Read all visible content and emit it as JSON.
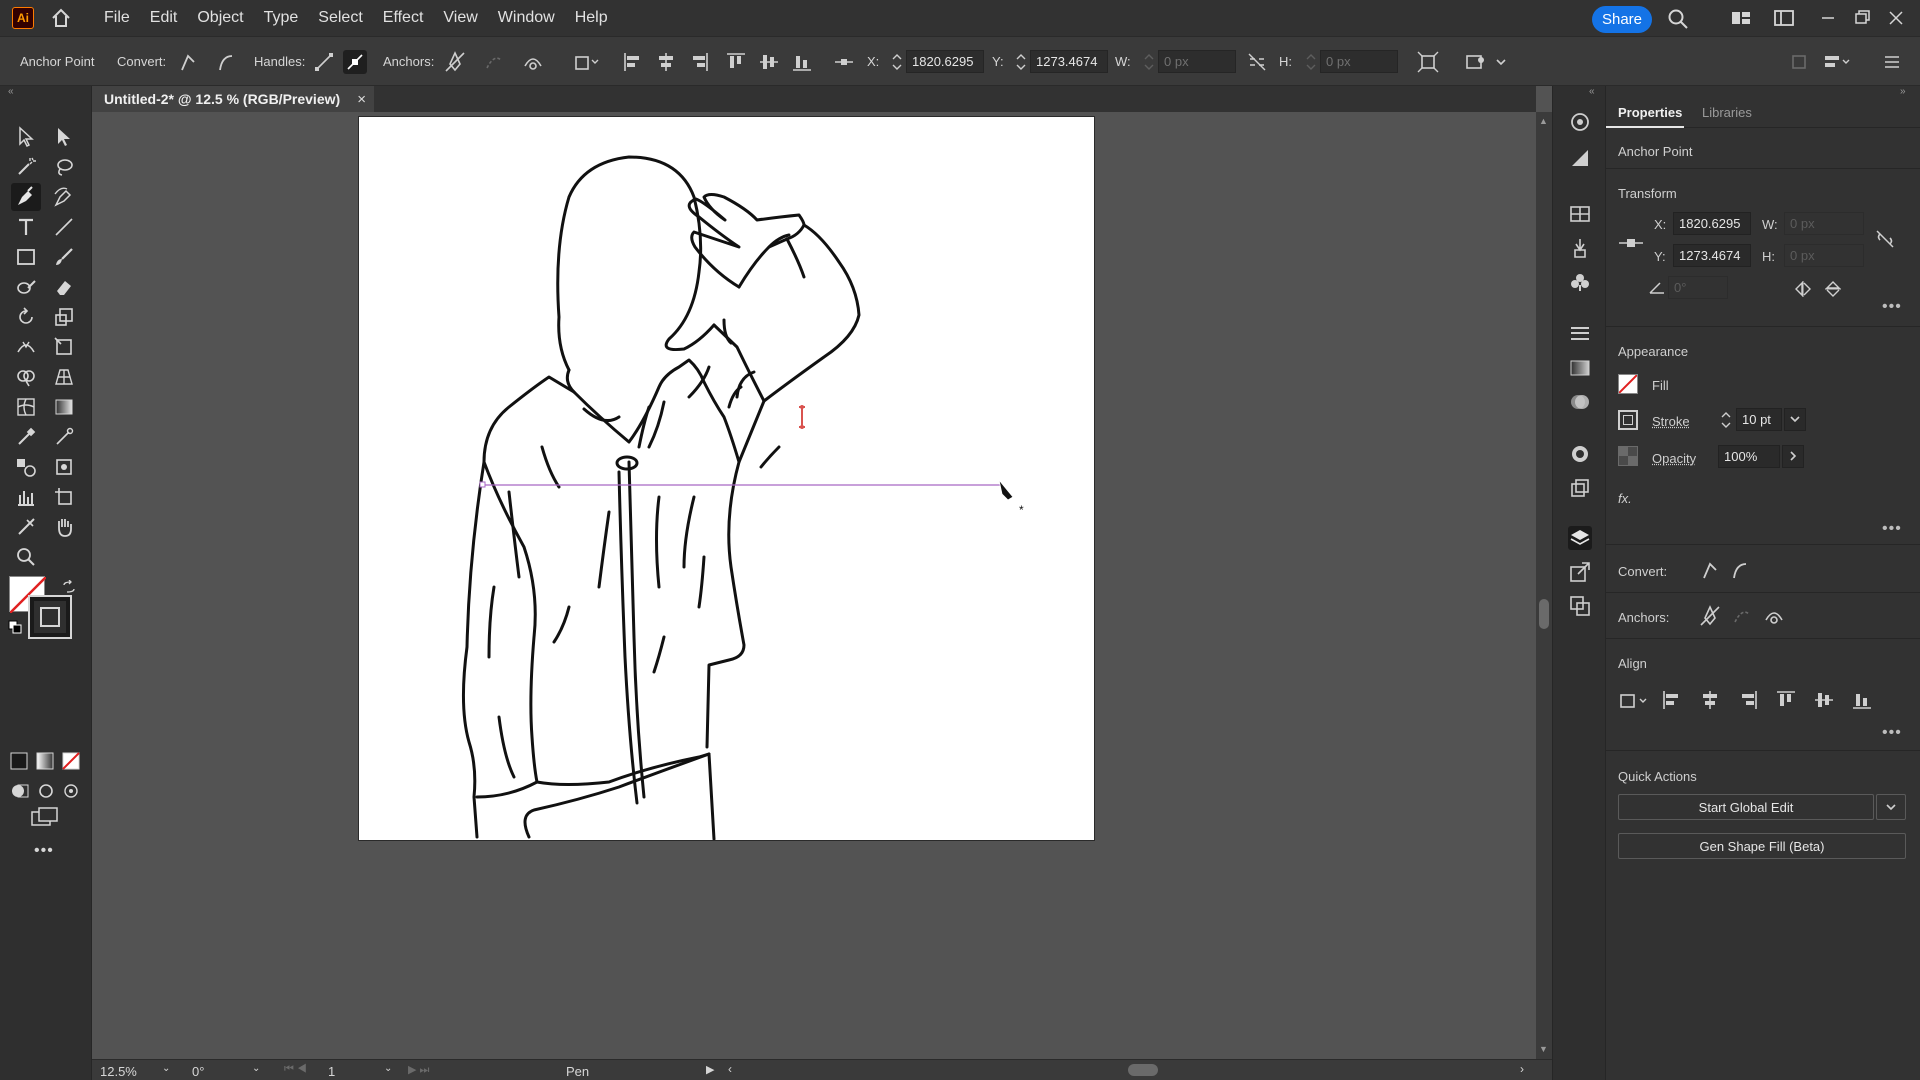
{
  "app": {
    "logo": "Ai"
  },
  "menu": [
    "File",
    "Edit",
    "Object",
    "Type",
    "Select",
    "Effect",
    "View",
    "Window",
    "Help"
  ],
  "share_label": "Share",
  "control_bar": {
    "tool_label": "Anchor Point",
    "convert_label": "Convert:",
    "handles_label": "Handles:",
    "anchors_label": "Anchors:",
    "x_label": "X:",
    "x_value": "1820.6295",
    "y_label": "Y:",
    "y_value": "1273.4674",
    "w_label": "W:",
    "w_value": "0 px",
    "h_label": "H:",
    "h_value": "0 px"
  },
  "document_tab": {
    "title": "Untitled-2* @ 12.5 % (RGB/Preview)",
    "close": "×"
  },
  "status_bar": {
    "zoom": "12.5%",
    "rotation": "0°",
    "artboard": "1",
    "tool": "Pen"
  },
  "properties": {
    "tabs": [
      "Properties",
      "Libraries"
    ],
    "selection": "Anchor Point",
    "transform": {
      "title": "Transform",
      "x_label": "X:",
      "x_value": "1820.6295",
      "y_label": "Y:",
      "y_value": "1273.4674",
      "w_label": "W:",
      "w_value": "0 px",
      "h_label": "H:",
      "h_value": "0 px",
      "angle_value": "0°"
    },
    "appearance": {
      "title": "Appearance",
      "fill_label": "Fill",
      "stroke_label": "Stroke",
      "stroke_value": "10 pt",
      "opacity_label": "Opacity",
      "opacity_value": "100%",
      "fx_label": "fx."
    },
    "convert_label": "Convert:",
    "anchors_label": "Anchors:",
    "align_title": "Align",
    "quick_actions": {
      "title": "Quick Actions",
      "global_edit": "Start Global Edit",
      "gen_shape_fill": "Gen Shape Fill (Beta)"
    }
  },
  "colors": {
    "accent": "#1473e6",
    "guide": "#a767c4",
    "anchor": "#d9534f"
  }
}
